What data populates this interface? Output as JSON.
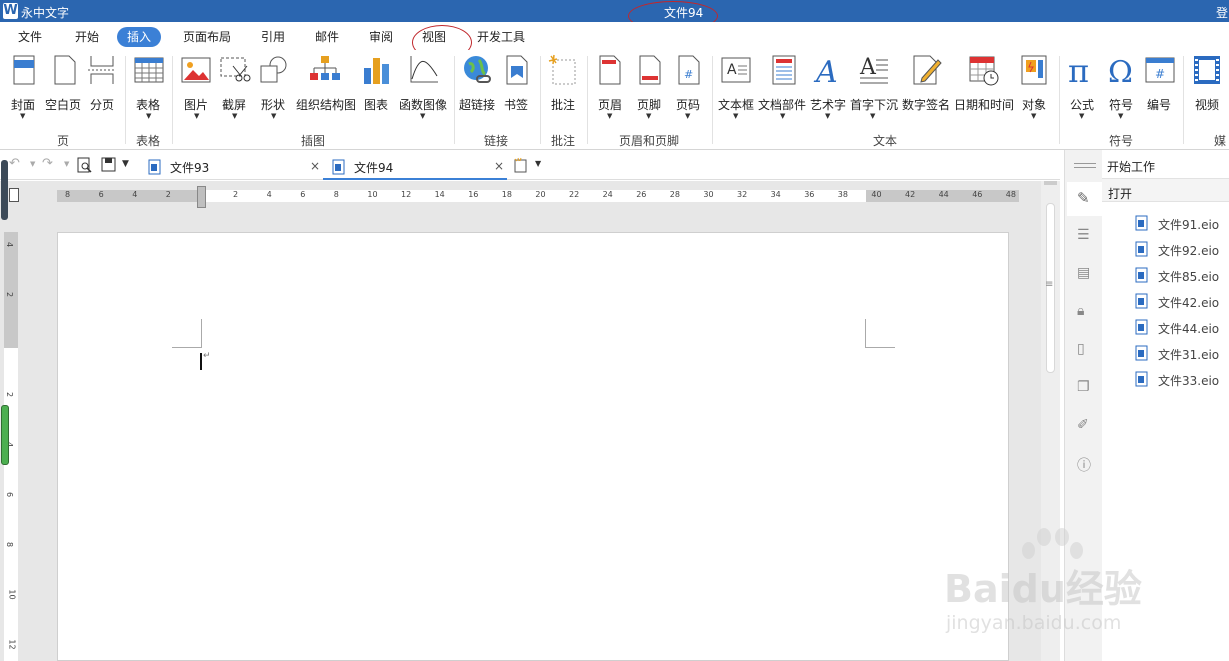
{
  "app": {
    "name": "永中文字",
    "document_title": "文件94",
    "login_label": "登"
  },
  "menu": {
    "items": [
      "文件",
      "开始",
      "插入",
      "页面布局",
      "引用",
      "邮件",
      "审阅",
      "视图",
      "开发工具"
    ],
    "active": "插入"
  },
  "ribbon": {
    "buttons": {
      "cover": "封面",
      "blank_page": "空白页",
      "page_break": "分页",
      "table": "表格",
      "picture": "图片",
      "screenshot": "截屏",
      "shape": "形状",
      "org_chart": "组织结构图",
      "chart": "图表",
      "function_image": "函数图像",
      "hyperlink": "超链接",
      "bookmark": "书签",
      "comment": "批注",
      "header": "页眉",
      "footer": "页脚",
      "page_number": "页码",
      "text_box": "文本框",
      "doc_parts": "文档部件",
      "word_art": "艺术字",
      "drop_cap": "首字下沉",
      "digital_signature": "数字签名",
      "date_time": "日期和时间",
      "object": "对象",
      "formula": "公式",
      "symbol": "符号",
      "numbering": "编号",
      "video": "视频"
    },
    "groups": {
      "page": "页",
      "table": "表格",
      "illustration": "插图",
      "link": "链接",
      "comment": "批注",
      "header_footer": "页眉和页脚",
      "text": "文本",
      "symbol": "符号",
      "media": "媒"
    }
  },
  "tabs": [
    {
      "label": "文件93",
      "close": "×"
    },
    {
      "label": "文件94",
      "close": "×"
    }
  ],
  "ruler": {
    "horizontal": [
      "8",
      "6",
      "4",
      "2",
      "",
      "2",
      "4",
      "6",
      "8",
      "10",
      "12",
      "14",
      "16",
      "18",
      "20",
      "22",
      "24",
      "26",
      "28",
      "30",
      "32",
      "34",
      "36",
      "38",
      "40",
      "42",
      "44",
      "46",
      "48"
    ],
    "vertical": [
      "4",
      "2",
      "",
      "2",
      "4",
      "6",
      "8",
      "10",
      "12"
    ]
  },
  "sidebar": {
    "title": "开始工作",
    "section": "打开",
    "files": [
      "文件91.eio",
      "文件92.eio",
      "文件85.eio",
      "文件42.eio",
      "文件44.eio",
      "文件31.eio",
      "文件33.eio"
    ]
  },
  "watermark": {
    "brand": "Baidu经验",
    "url": "jingyan.baidu.com"
  },
  "colors": {
    "titlebar": "#2b66b0",
    "active_menu": "#3b80d6",
    "annotation_circle": "#c0282d"
  }
}
